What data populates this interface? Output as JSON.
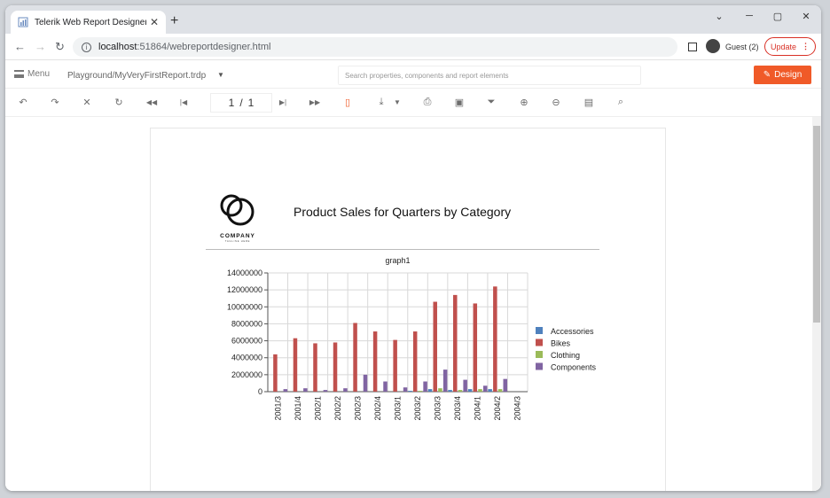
{
  "browser": {
    "tab_title": "Telerik Web Report Designer Dem",
    "tab_close": "✕",
    "new_tab": "+",
    "url_host": "localhost",
    "url_path": ":51864/webreportdesigner.html",
    "profile": "Guest (2)",
    "update": "Update"
  },
  "app": {
    "menu": "Menu",
    "report_path": "Playground/MyVeryFirstReport.trdp",
    "search_placeholder": "Search properties, components and report elements",
    "design_button": "Design"
  },
  "toolbar": {
    "page_current": "1",
    "page_sep": "/",
    "page_total": "1"
  },
  "report": {
    "title": "Product Sales for Quarters by Category",
    "logo_text": "COMPANY",
    "logo_tagline": "TAGLINE HERE"
  },
  "chart_data": {
    "type": "bar",
    "title": "graph1",
    "categories": [
      "2001/3",
      "2001/4",
      "2002/1",
      "2002/2",
      "2002/3",
      "2002/4",
      "2003/1",
      "2003/2",
      "2003/3",
      "2003/4",
      "2004/1",
      "2004/2",
      "2004/3"
    ],
    "ylim": [
      0,
      14000000
    ],
    "yticks": [
      0,
      2000000,
      4000000,
      6000000,
      8000000,
      10000000,
      12000000,
      14000000
    ],
    "legend_position": "right",
    "series": [
      {
        "name": "Accessories",
        "color": "#4f81bd",
        "values": [
          0,
          0,
          0,
          0,
          0,
          0,
          0,
          100000,
          300000,
          200000,
          300000,
          300000,
          0
        ]
      },
      {
        "name": "Bikes",
        "color": "#c0504d",
        "values": [
          4400000,
          6300000,
          5700000,
          5800000,
          8100000,
          7100000,
          6100000,
          7100000,
          10600000,
          11400000,
          10400000,
          12400000,
          0
        ]
      },
      {
        "name": "Clothing",
        "color": "#9bbb59",
        "values": [
          0,
          0,
          0,
          0,
          0,
          0,
          0,
          100000,
          400000,
          200000,
          300000,
          300000,
          0
        ]
      },
      {
        "name": "Components",
        "color": "#8064a2",
        "values": [
          300000,
          400000,
          200000,
          400000,
          2000000,
          1200000,
          500000,
          1200000,
          2600000,
          1400000,
          700000,
          1500000,
          0
        ]
      }
    ]
  }
}
